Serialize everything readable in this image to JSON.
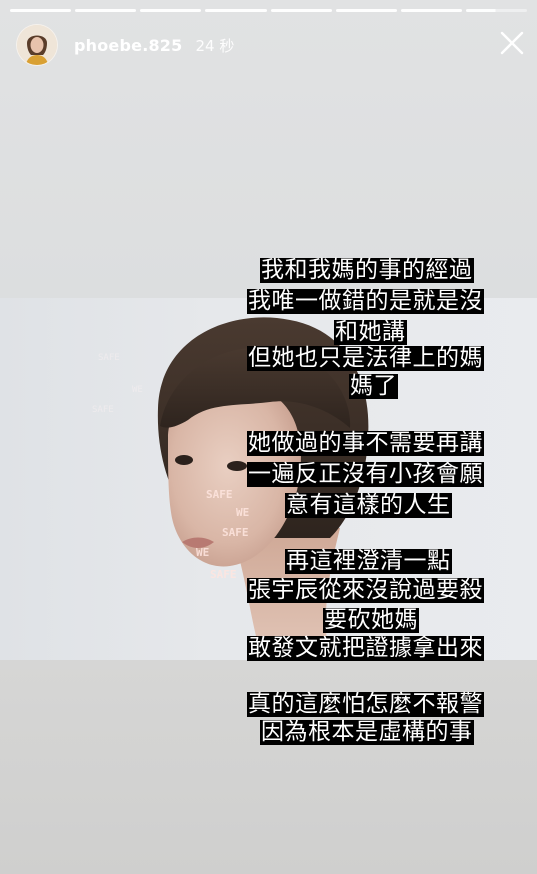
{
  "story": {
    "username": "phoebe.825",
    "time_ago": "24 秒",
    "segments": 8,
    "current_segment": 8,
    "current_segment_progress": 0.48
  },
  "caption_lines": [
    "我和我媽的事的經過",
    "我唯一做錯的是就是沒",
    "和她講",
    "但她也只是法律上的媽",
    "媽了",
    "她做過的事不需要再講",
    "一遍反正沒有小孩會願",
    "意有這樣的人生",
    "再這裡澄清一點",
    "張宇辰從來沒說過要殺",
    "要砍她媽",
    "敢發文就把證據拿出來",
    "真的這麼怕怎麼不報警",
    "因為根本是虛構的事"
  ],
  "photo_projection_text": [
    "SAFE",
    "WE",
    "SAFE",
    "WE",
    "SAFE"
  ],
  "icons": {
    "avatar": "profile-avatar",
    "close": "close-icon"
  }
}
